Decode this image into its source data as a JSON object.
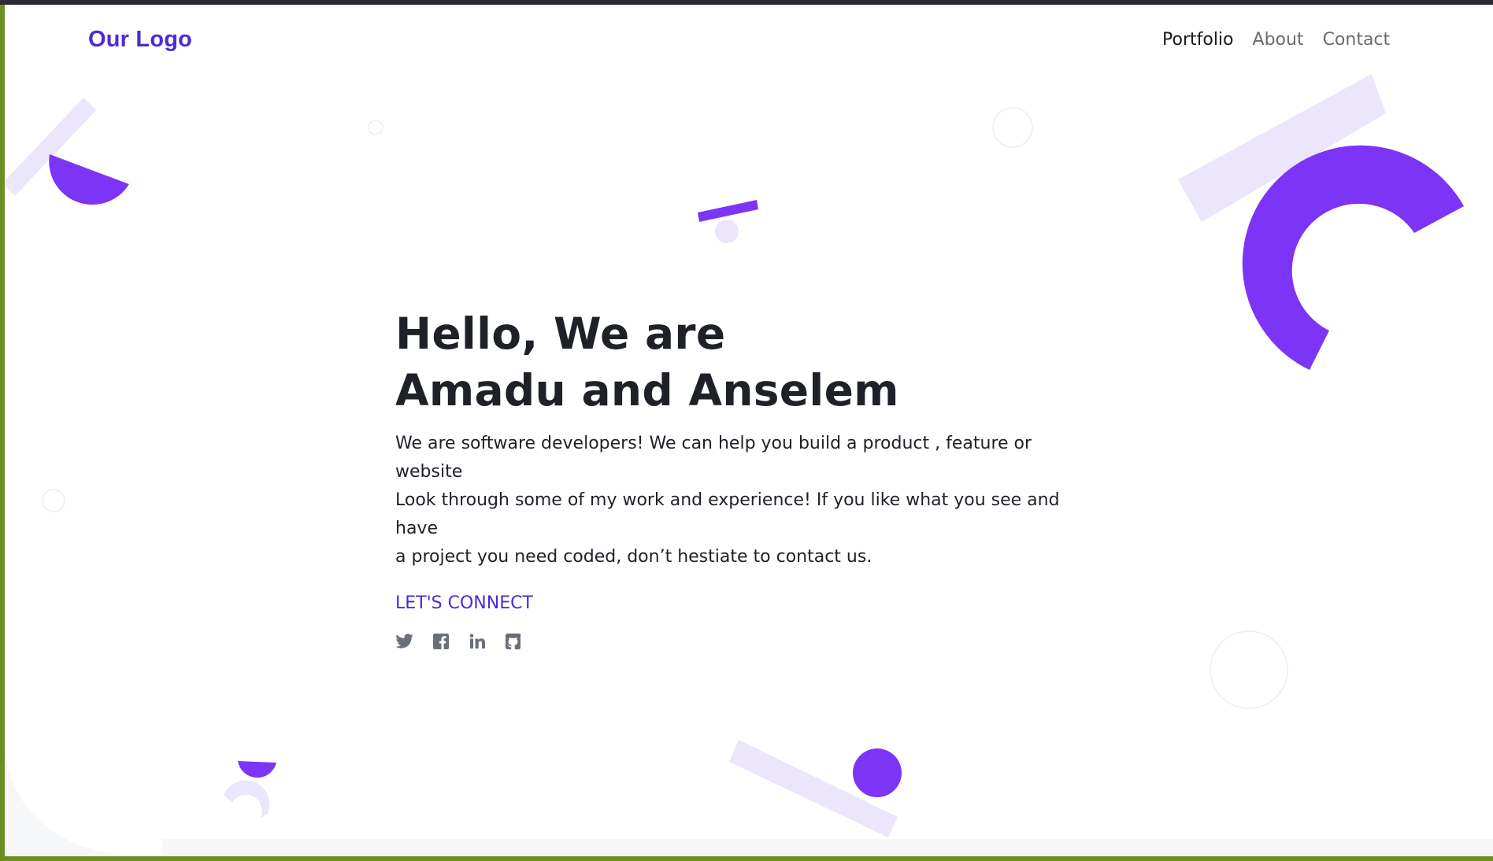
{
  "logo": {
    "text": "Our Logo"
  },
  "nav": {
    "items": [
      "Portfolio",
      "About",
      "Contact"
    ],
    "active": "Portfolio"
  },
  "hero": {
    "title_line1": "Hello, We are",
    "title_line2": "Amadu and Anselem",
    "description_line1": "We are software developers! We can help you build a product , feature or website",
    "description_line2": "Look through some of my work and experience! If you like what you see and have",
    "description_line3": "a project you need coded, don’t hestiate to contact us.",
    "cta": "LET'S CONNECT"
  },
  "socials": [
    {
      "icon": "twitter-icon"
    },
    {
      "icon": "facebook-icon"
    },
    {
      "icon": "linkedin-icon"
    },
    {
      "icon": "github-icon"
    }
  ],
  "colors": {
    "accent": "#7c35f7",
    "accent_light": "#ebe6fb",
    "logo": "#4c2ad9",
    "text": "#1f2128",
    "icon": "#6a6f78"
  }
}
